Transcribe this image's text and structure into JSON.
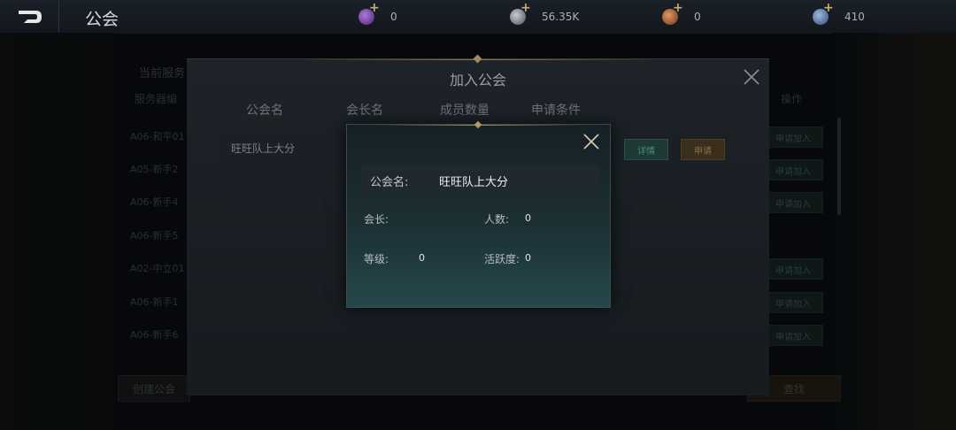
{
  "topbar": {
    "title": "公会",
    "currencies": [
      {
        "icon": "purple-gem-icon",
        "color": "#6b3a9a",
        "value": "0"
      },
      {
        "icon": "silver-coin-icon",
        "color": "#7a7f85",
        "value": "56.35K"
      },
      {
        "icon": "bronze-coin-icon",
        "color": "#9a5a33",
        "value": "0"
      },
      {
        "icon": "blue-gem-icon",
        "color": "#4f6f9a",
        "value": "410"
      }
    ]
  },
  "background": {
    "tab_label": "当前服务",
    "header_left": "服务器编",
    "header_right": "操作",
    "rows": [
      "A06-和平01",
      "A05-新手2",
      "A06-新手4",
      "A06-新手5",
      "A02-中立01",
      "A06-新手1",
      "A06-新手6"
    ],
    "row_button_label": "申请加入",
    "bottom_left_button": "创建公会",
    "bottom_right_button": "查找"
  },
  "join_panel": {
    "title": "加入公会",
    "columns": [
      "公会名",
      "会长名",
      "成员数量",
      "申请条件"
    ],
    "row": {
      "guild_name": "旺旺队上大分",
      "detail_label": "详情",
      "apply_label": "申请"
    }
  },
  "guild_info": {
    "name_label": "公会名:",
    "name_value": "旺旺队上大分",
    "leader_label": "会长:",
    "leader_value": "",
    "members_label": "人数:",
    "members_value": "0",
    "level_label": "等级:",
    "level_value": "0",
    "activity_label": "活跃度:",
    "activity_value": "0"
  }
}
